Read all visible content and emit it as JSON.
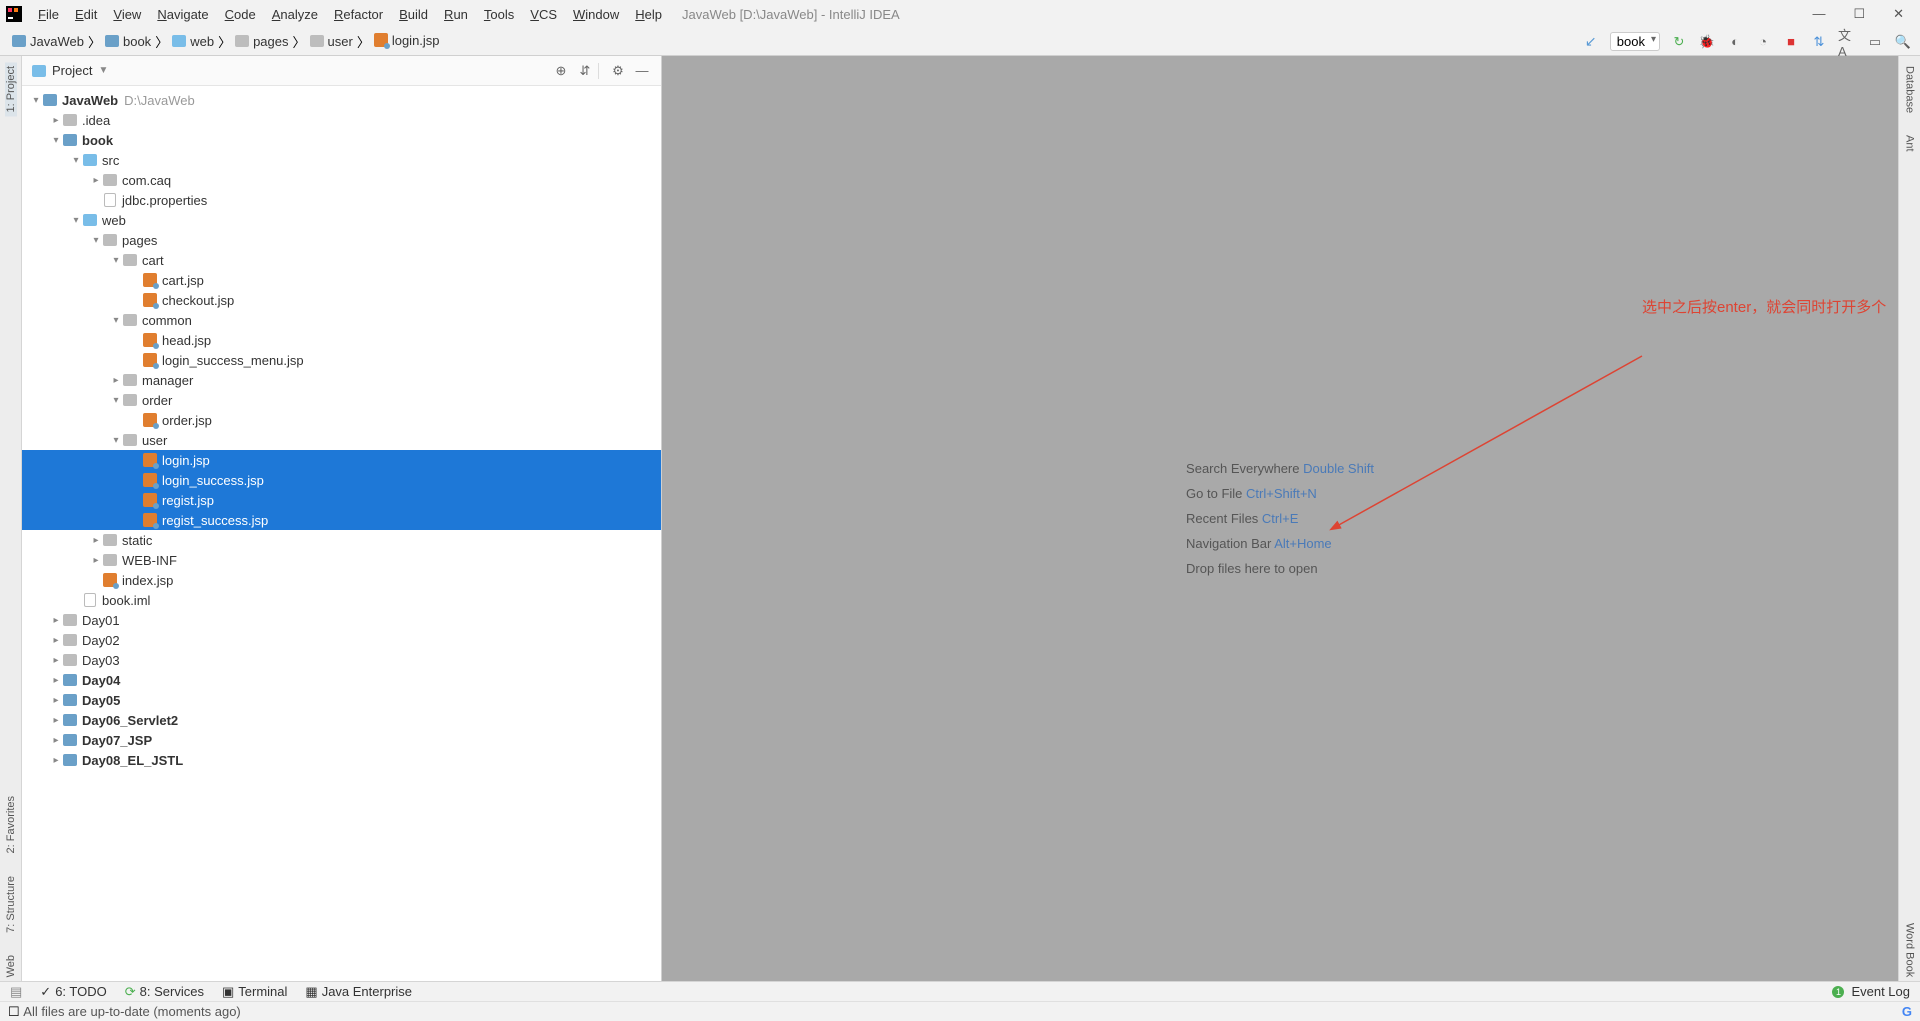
{
  "window_title": "JavaWeb [D:\\JavaWeb] - IntelliJ IDEA",
  "menus": [
    "File",
    "Edit",
    "View",
    "Navigate",
    "Code",
    "Analyze",
    "Refactor",
    "Build",
    "Run",
    "Tools",
    "VCS",
    "Window",
    "Help"
  ],
  "breadcrumbs": [
    "JavaWeb",
    "book",
    "web",
    "pages",
    "user",
    "login.jsp"
  ],
  "run_config": "book",
  "panel": {
    "title": "Project"
  },
  "tree": [
    {
      "d": 0,
      "t": "dir-root",
      "a": "down",
      "bold": true,
      "label": "JavaWeb",
      "hint": "D:\\JavaWeb"
    },
    {
      "d": 1,
      "t": "dir",
      "a": "right",
      "label": ".idea"
    },
    {
      "d": 1,
      "t": "dir-mod",
      "a": "down",
      "bold": true,
      "label": "book"
    },
    {
      "d": 2,
      "t": "dir-src",
      "a": "down",
      "label": "src"
    },
    {
      "d": 3,
      "t": "pkg",
      "a": "right",
      "label": "com.caq"
    },
    {
      "d": 3,
      "t": "props",
      "label": "jdbc.properties"
    },
    {
      "d": 2,
      "t": "dir-web",
      "a": "down",
      "label": "web"
    },
    {
      "d": 3,
      "t": "dir",
      "a": "down",
      "label": "pages"
    },
    {
      "d": 4,
      "t": "dir",
      "a": "down",
      "label": "cart"
    },
    {
      "d": 5,
      "t": "jsp",
      "label": "cart.jsp"
    },
    {
      "d": 5,
      "t": "jsp",
      "label": "checkout.jsp"
    },
    {
      "d": 4,
      "t": "dir",
      "a": "down",
      "label": "common"
    },
    {
      "d": 5,
      "t": "jsp",
      "label": "head.jsp"
    },
    {
      "d": 5,
      "t": "jsp",
      "label": "login_success_menu.jsp"
    },
    {
      "d": 4,
      "t": "dir",
      "a": "right",
      "label": "manager"
    },
    {
      "d": 4,
      "t": "dir",
      "a": "down",
      "label": "order"
    },
    {
      "d": 5,
      "t": "jsp",
      "label": "order.jsp"
    },
    {
      "d": 4,
      "t": "dir",
      "a": "down",
      "label": "user"
    },
    {
      "d": 5,
      "t": "jsp",
      "label": "login.jsp",
      "sel": true
    },
    {
      "d": 5,
      "t": "jsp",
      "label": "login_success.jsp",
      "sel": true
    },
    {
      "d": 5,
      "t": "jsp",
      "label": "regist.jsp",
      "sel": true
    },
    {
      "d": 5,
      "t": "jsp",
      "label": "regist_success.jsp",
      "sel": true
    },
    {
      "d": 3,
      "t": "dir",
      "a": "right",
      "label": "static"
    },
    {
      "d": 3,
      "t": "dir",
      "a": "right",
      "label": "WEB-INF"
    },
    {
      "d": 3,
      "t": "jsp",
      "label": "index.jsp"
    },
    {
      "d": 2,
      "t": "iml",
      "label": "book.iml"
    },
    {
      "d": 1,
      "t": "dir",
      "a": "right",
      "label": "Day01"
    },
    {
      "d": 1,
      "t": "dir",
      "a": "right",
      "label": "Day02"
    },
    {
      "d": 1,
      "t": "dir",
      "a": "right",
      "label": "Day03"
    },
    {
      "d": 1,
      "t": "dir-mod",
      "a": "right",
      "bold": true,
      "label": "Day04"
    },
    {
      "d": 1,
      "t": "dir-mod",
      "a": "right",
      "bold": true,
      "label": "Day05"
    },
    {
      "d": 1,
      "t": "dir-mod",
      "a": "right",
      "bold": true,
      "label": "Day06_Servlet2"
    },
    {
      "d": 1,
      "t": "dir-mod",
      "a": "right",
      "bold": true,
      "label": "Day07_JSP"
    },
    {
      "d": 1,
      "t": "dir-mod",
      "a": "right",
      "bold": true,
      "label": "Day08_EL_JSTL"
    }
  ],
  "editor_hints": [
    {
      "text": "Search Everywhere ",
      "kbd": "Double Shift"
    },
    {
      "text": "Go to File ",
      "kbd": "Ctrl+Shift+N"
    },
    {
      "text": "Recent Files ",
      "kbd": "Ctrl+E"
    },
    {
      "text": "Navigation Bar ",
      "kbd": "Alt+Home"
    },
    {
      "text": "Drop files here to open",
      "kbd": ""
    }
  ],
  "annotation": "选中之后按enter，就会同时打开多个",
  "left_gutter": [
    "1: Project"
  ],
  "left_gutter_bottom": [
    "2: Favorites",
    "7: Structure",
    "Web"
  ],
  "right_gutter": [
    "Database",
    "Ant",
    "Word Book"
  ],
  "bottom_tools": {
    "todo": "6: TODO",
    "services": "8: Services",
    "terminal": "Terminal",
    "java_ee": "Java Enterprise",
    "event": "Event Log"
  },
  "status": "All files are up-to-date (moments ago)"
}
